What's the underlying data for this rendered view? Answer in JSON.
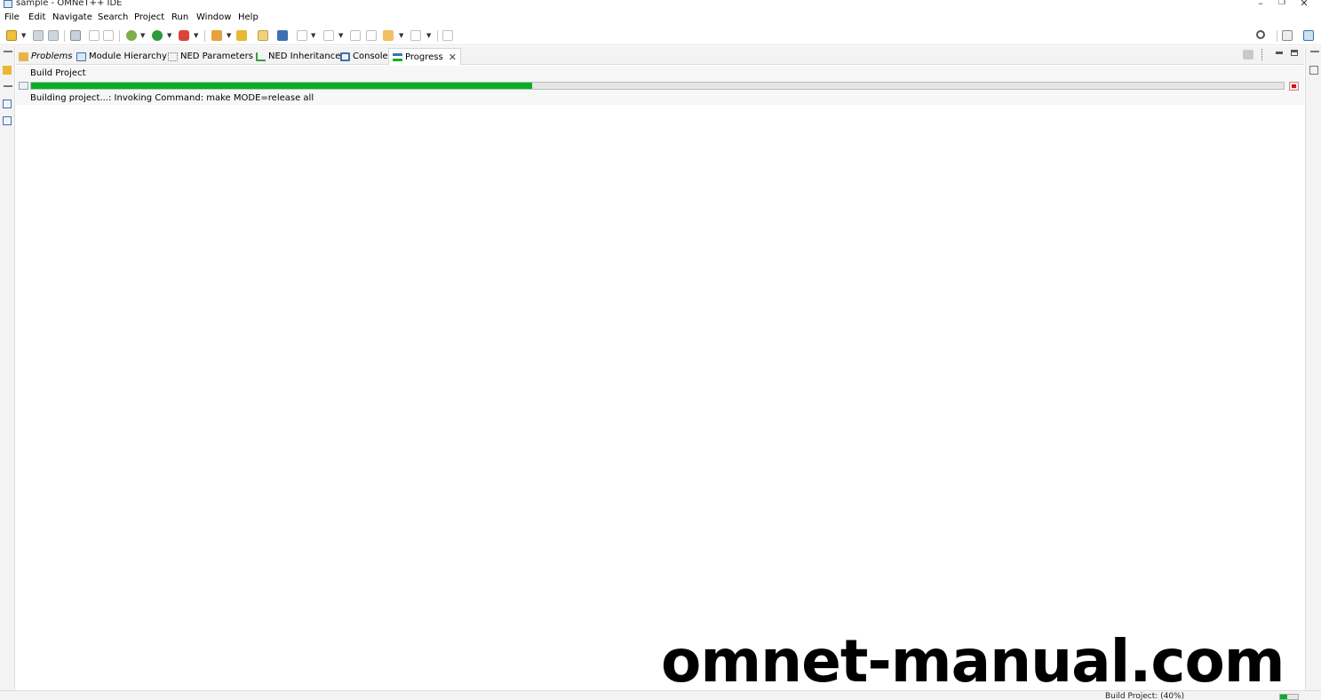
{
  "window": {
    "title": "sample - OMNeT++ IDE",
    "minimize": "–",
    "restore": "❐",
    "close": "✕"
  },
  "menu": [
    "File",
    "Edit",
    "Navigate",
    "Search",
    "Project",
    "Run",
    "Window",
    "Help"
  ],
  "tabs": [
    {
      "label": "Problems",
      "icon": "problems-icon"
    },
    {
      "label": "Module Hierarchy",
      "icon": "module-hierarchy-icon"
    },
    {
      "label": "NED Parameters",
      "icon": "ned-parameters-icon"
    },
    {
      "label": "NED Inheritance",
      "icon": "ned-inheritance-icon"
    },
    {
      "label": "Console",
      "icon": "console-icon"
    },
    {
      "label": "Progress",
      "icon": "progress-icon",
      "active": true,
      "close": "✕"
    }
  ],
  "progress": {
    "job_name": "Build Project",
    "fraction": 0.4,
    "status": "Building project...: Invoking Command: make MODE=release all"
  },
  "statusbar": {
    "text": "Build Project: (40%)"
  },
  "watermark": "omnet-manual.com",
  "colors": {
    "progress_green": "#06b025",
    "stop_red": "#dd1111"
  }
}
